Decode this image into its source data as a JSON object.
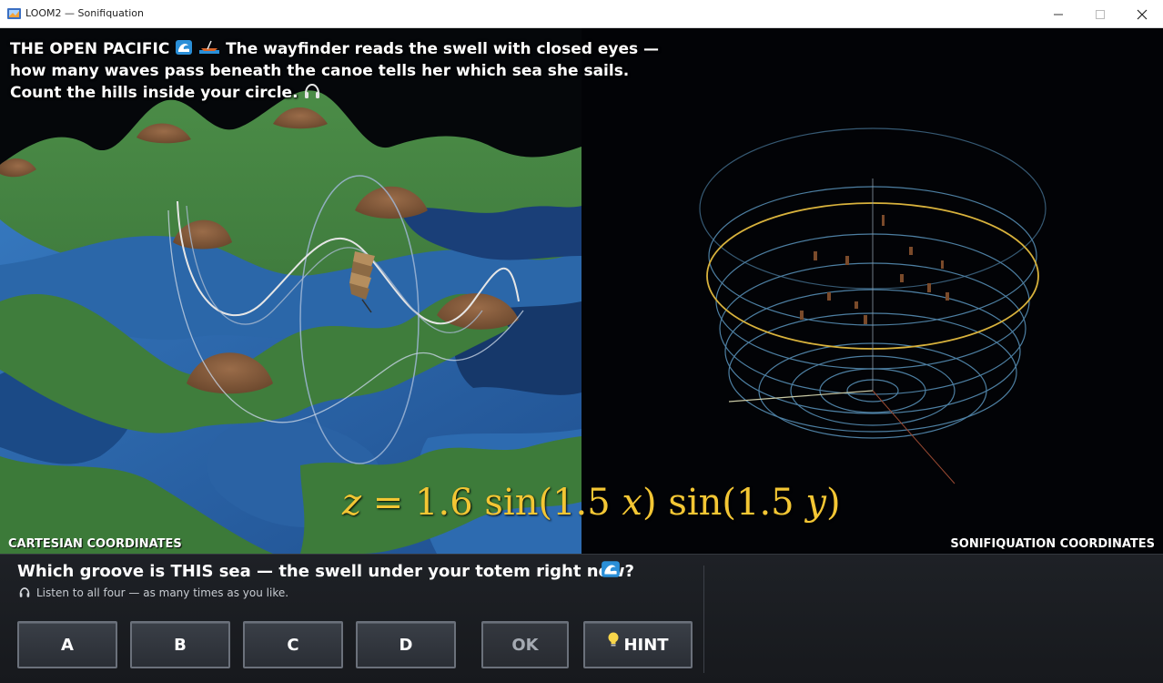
{
  "window": {
    "title": "LOOM2 — Sonifiquation",
    "icons": [
      "app-icon",
      "minimize-icon",
      "maximize-icon",
      "close-icon"
    ]
  },
  "scene": {
    "prompt": {
      "heading": "THE OPEN PACIFIC",
      "line1_text": "The wayfinder reads the swell with closed eyes —",
      "line2": "how many waves pass beneath the canoe tells her which sea she sails.",
      "line3": "Count the hills inside your circle.",
      "icons": [
        "wave-icon",
        "canoe-icon",
        "headphones-icon"
      ]
    },
    "equation": {
      "lhs": "z",
      "eq": "=",
      "coef": "1.6",
      "fn1": "sin",
      "arg1_num": "1.5",
      "arg1_var": "x",
      "fn2": "sin",
      "arg2_num": "1.5",
      "arg2_var": "y"
    },
    "left_label": "CARTESIAN COORDINATES",
    "right_label": "SONIFIQUATION COORDINATES",
    "colors": {
      "grass": "#3d7a3a",
      "water": "#2f6db0",
      "deep_water": "#163a70",
      "hill_top": "#8a6142",
      "ring": "#5d8fb0",
      "highlight_ring": "#d8b23c",
      "equation": "#f3c634"
    }
  },
  "question": {
    "text": "Which groove is THIS sea — the swell under your totem right now?",
    "subtext": "Listen to all four — as many times as you like.",
    "icons": [
      "wave-icon",
      "headphones-icon"
    ]
  },
  "buttons": {
    "a": "A",
    "b": "B",
    "c": "C",
    "d": "D",
    "ok": "OK",
    "hint": "HINT",
    "hint_icon": "lightbulb-icon",
    "ok_state": "disabled"
  }
}
